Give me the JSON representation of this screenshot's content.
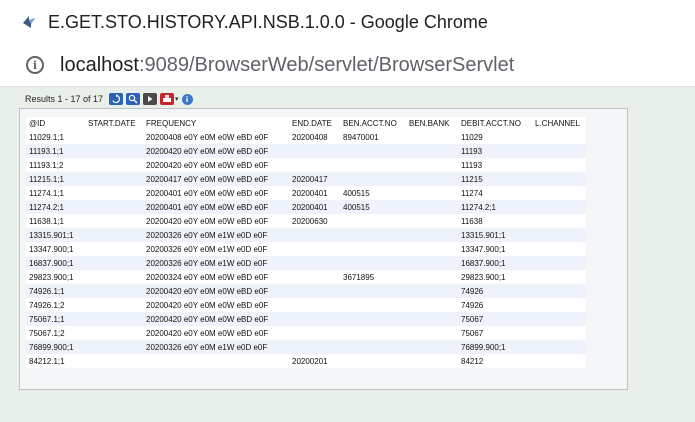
{
  "window": {
    "title": "E.GET.STO.HISTORY.API.NSB.1.0.0 - Google Chrome"
  },
  "address_bar": {
    "host": "localhost",
    "path": ":9089/BrowserWeb/servlet/BrowserServlet"
  },
  "toolbar": {
    "results_label": "Results 1 - 17 of 17",
    "icons": [
      "refresh-icon",
      "search-icon",
      "next-icon",
      "print-icon",
      "info-icon"
    ]
  },
  "table": {
    "columns": [
      "@ID",
      "START.DATE",
      "FREQUENCY",
      "END.DATE",
      "BEN.ACCT.NO",
      "BEN.BANK",
      "DEBIT.ACCT.NO",
      "L.CHANNEL"
    ],
    "rows": [
      [
        "11029.1;1",
        "",
        "20200408 e0Y e0M e0W eBD e0F",
        "20200408",
        "89470001",
        "",
        "11029",
        ""
      ],
      [
        "11193.1;1",
        "",
        "20200420 e0Y e0M e0W eBD e0F",
        "",
        "",
        "",
        "11193",
        ""
      ],
      [
        "11193.1;2",
        "",
        "20200420 e0Y e0M e0W eBD e0F",
        "",
        "",
        "",
        "11193",
        ""
      ],
      [
        "11215.1;1",
        "",
        "20200417 e0Y e0M e0W eBD e0F",
        "20200417",
        "",
        "",
        "11215",
        ""
      ],
      [
        "11274.1;1",
        "",
        "20200401 e0Y e0M e0W eBD e0F",
        "20200401",
        "400515",
        "",
        "11274",
        ""
      ],
      [
        "11274.2;1",
        "",
        "20200401 e0Y e0M e0W eBD e0F",
        "20200401",
        "400515",
        "",
        "11274.2;1",
        ""
      ],
      [
        "11638.1;1",
        "",
        "20200420 e0Y e0M e0W eBD e0F",
        "20200630",
        "",
        "",
        "11638",
        ""
      ],
      [
        "13315.901;1",
        "",
        "20200326 e0Y e0M e1W e0D e0F",
        "",
        "",
        "",
        "13315.901;1",
        ""
      ],
      [
        "13347.900;1",
        "",
        "20200326 e0Y e0M e1W e0D e0F",
        "",
        "",
        "",
        "13347.900;1",
        ""
      ],
      [
        "16837.900;1",
        "",
        "20200326 e0Y e0M e1W e0D e0F",
        "",
        "",
        "",
        "16837.900;1",
        ""
      ],
      [
        "29823.900;1",
        "",
        "20200324 e0Y e0M e0W eBD e0F",
        "",
        "3671895",
        "",
        "29823.900;1",
        ""
      ],
      [
        "74926.1;1",
        "",
        "20200420 e0Y e0M e0W eBD e0F",
        "",
        "",
        "",
        "74926",
        ""
      ],
      [
        "74926.1;2",
        "",
        "20200420 e0Y e0M e0W eBD e0F",
        "",
        "",
        "",
        "74926",
        ""
      ],
      [
        "75067.1;1",
        "",
        "20200420 e0Y e0M e0W eBD e0F",
        "",
        "",
        "",
        "75067",
        ""
      ],
      [
        "75067.1;2",
        "",
        "20200420 e0Y e0M e0W eBD e0F",
        "",
        "",
        "",
        "75067",
        ""
      ],
      [
        "76899.900;1",
        "",
        "20200326 e0Y e0M e1W e0D e0F",
        "",
        "",
        "",
        "76899.900;1",
        ""
      ],
      [
        "84212.1;1",
        "",
        "",
        "20200201",
        "",
        "",
        "84212",
        ""
      ]
    ]
  },
  "colors": {
    "page_bg": "#e9f0e9",
    "panel_bg": "#f4f6f8",
    "row_alt": "#eef2fb"
  }
}
